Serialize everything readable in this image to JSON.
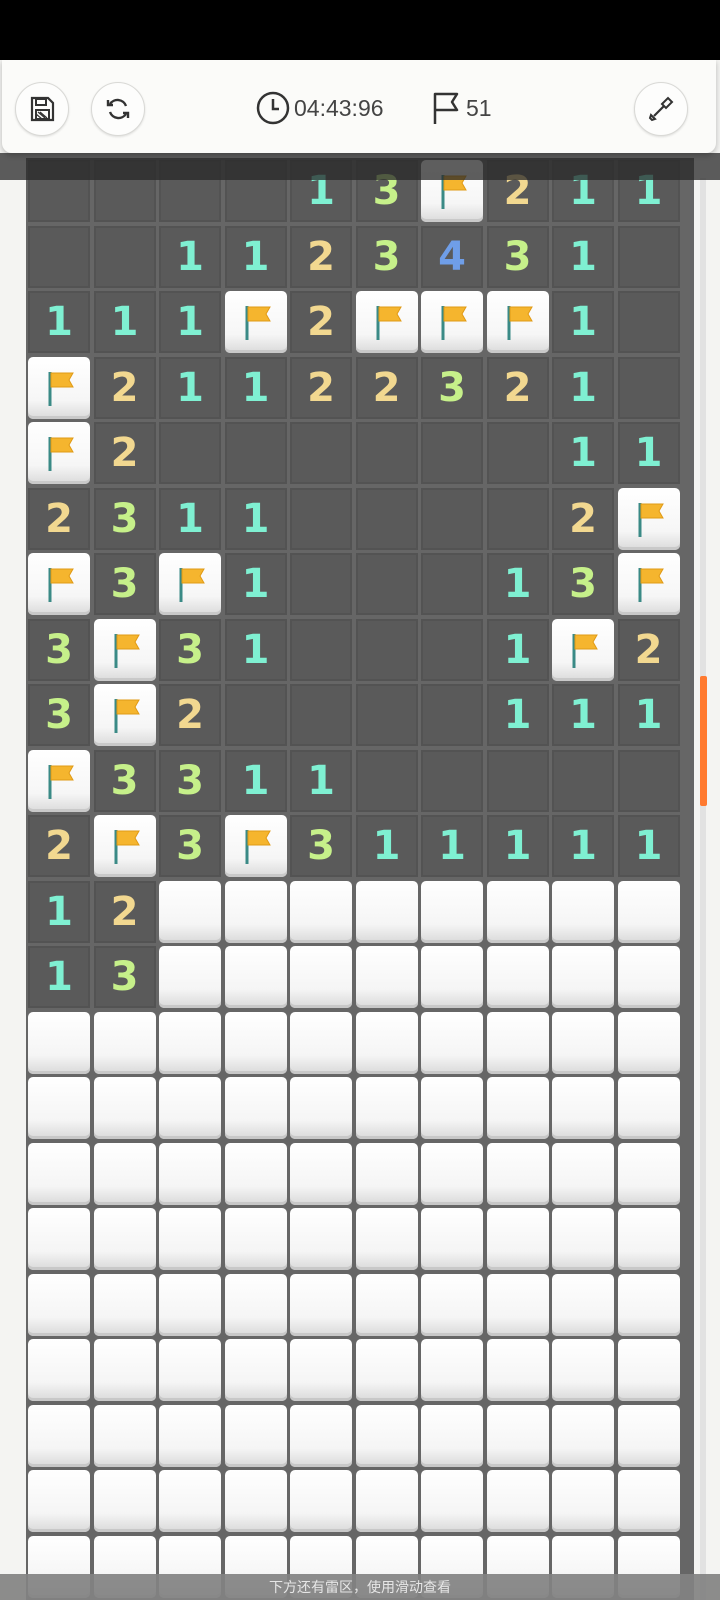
{
  "toolbar": {
    "save_icon": "save-icon",
    "restart_icon": "restart-icon",
    "timer_icon": "clock-icon",
    "timer": "04:43:96",
    "flag_icon": "flag-outline-icon",
    "flags_remaining": "51",
    "dig_icon": "shovel-icon"
  },
  "colors": {
    "accent": "#ff7a30",
    "board": "#666666",
    "revealed_cell": "#5a5a5a",
    "number_1": "#7ff0d2",
    "number_2": "#f2d890",
    "number_3": "#c6f08a",
    "number_4": "#6f9ee8",
    "flag": "#f5b52e"
  },
  "board": {
    "columns": 10,
    "legend": "R = revealed empty, digits = revealed number, F = flag, H = hidden",
    "rows": [
      [
        "R",
        "R",
        "R",
        "R",
        "1",
        "3",
        "F",
        "2",
        "1",
        "1"
      ],
      [
        "R",
        "R",
        "1",
        "1",
        "2",
        "3",
        "4",
        "3",
        "1",
        "R"
      ],
      [
        "1",
        "1",
        "1",
        "F",
        "2",
        "F",
        "F",
        "F",
        "1",
        "R"
      ],
      [
        "F",
        "2",
        "1",
        "1",
        "2",
        "2",
        "3",
        "2",
        "1",
        "R"
      ],
      [
        "F",
        "2",
        "R",
        "R",
        "R",
        "R",
        "R",
        "R",
        "1",
        "1"
      ],
      [
        "2",
        "3",
        "1",
        "1",
        "R",
        "R",
        "R",
        "R",
        "2",
        "F"
      ],
      [
        "F",
        "3",
        "F",
        "1",
        "R",
        "R",
        "R",
        "1",
        "3",
        "F"
      ],
      [
        "3",
        "F",
        "3",
        "1",
        "R",
        "R",
        "R",
        "1",
        "F",
        "2"
      ],
      [
        "3",
        "F",
        "2",
        "R",
        "R",
        "R",
        "R",
        "1",
        "1",
        "1"
      ],
      [
        "F",
        "3",
        "3",
        "1",
        "1",
        "R",
        "R",
        "R",
        "R",
        "R"
      ],
      [
        "2",
        "F",
        "3",
        "F",
        "3",
        "1",
        "1",
        "1",
        "1",
        "1"
      ],
      [
        "1",
        "2",
        "H",
        "H",
        "H",
        "H",
        "H",
        "H",
        "H",
        "H"
      ],
      [
        "1",
        "3",
        "H",
        "H",
        "H",
        "H",
        "H",
        "H",
        "H",
        "H"
      ],
      [
        "H",
        "H",
        "H",
        "H",
        "H",
        "H",
        "H",
        "H",
        "H",
        "H"
      ],
      [
        "H",
        "H",
        "H",
        "H",
        "H",
        "H",
        "H",
        "H",
        "H",
        "H"
      ],
      [
        "H",
        "H",
        "H",
        "H",
        "H",
        "H",
        "H",
        "H",
        "H",
        "H"
      ],
      [
        "H",
        "H",
        "H",
        "H",
        "H",
        "H",
        "H",
        "H",
        "H",
        "H"
      ],
      [
        "H",
        "H",
        "H",
        "H",
        "H",
        "H",
        "H",
        "H",
        "H",
        "H"
      ],
      [
        "H",
        "H",
        "H",
        "H",
        "H",
        "H",
        "H",
        "H",
        "H",
        "H"
      ],
      [
        "H",
        "H",
        "H",
        "H",
        "H",
        "H",
        "H",
        "H",
        "H",
        "H"
      ],
      [
        "H",
        "H",
        "H",
        "H",
        "H",
        "H",
        "H",
        "H",
        "H",
        "H"
      ],
      [
        "H",
        "H",
        "H",
        "H",
        "H",
        "H",
        "H",
        "H",
        "H",
        "H"
      ]
    ]
  },
  "footer": {
    "hint": "下方还有雷区，使用滑动查看"
  }
}
